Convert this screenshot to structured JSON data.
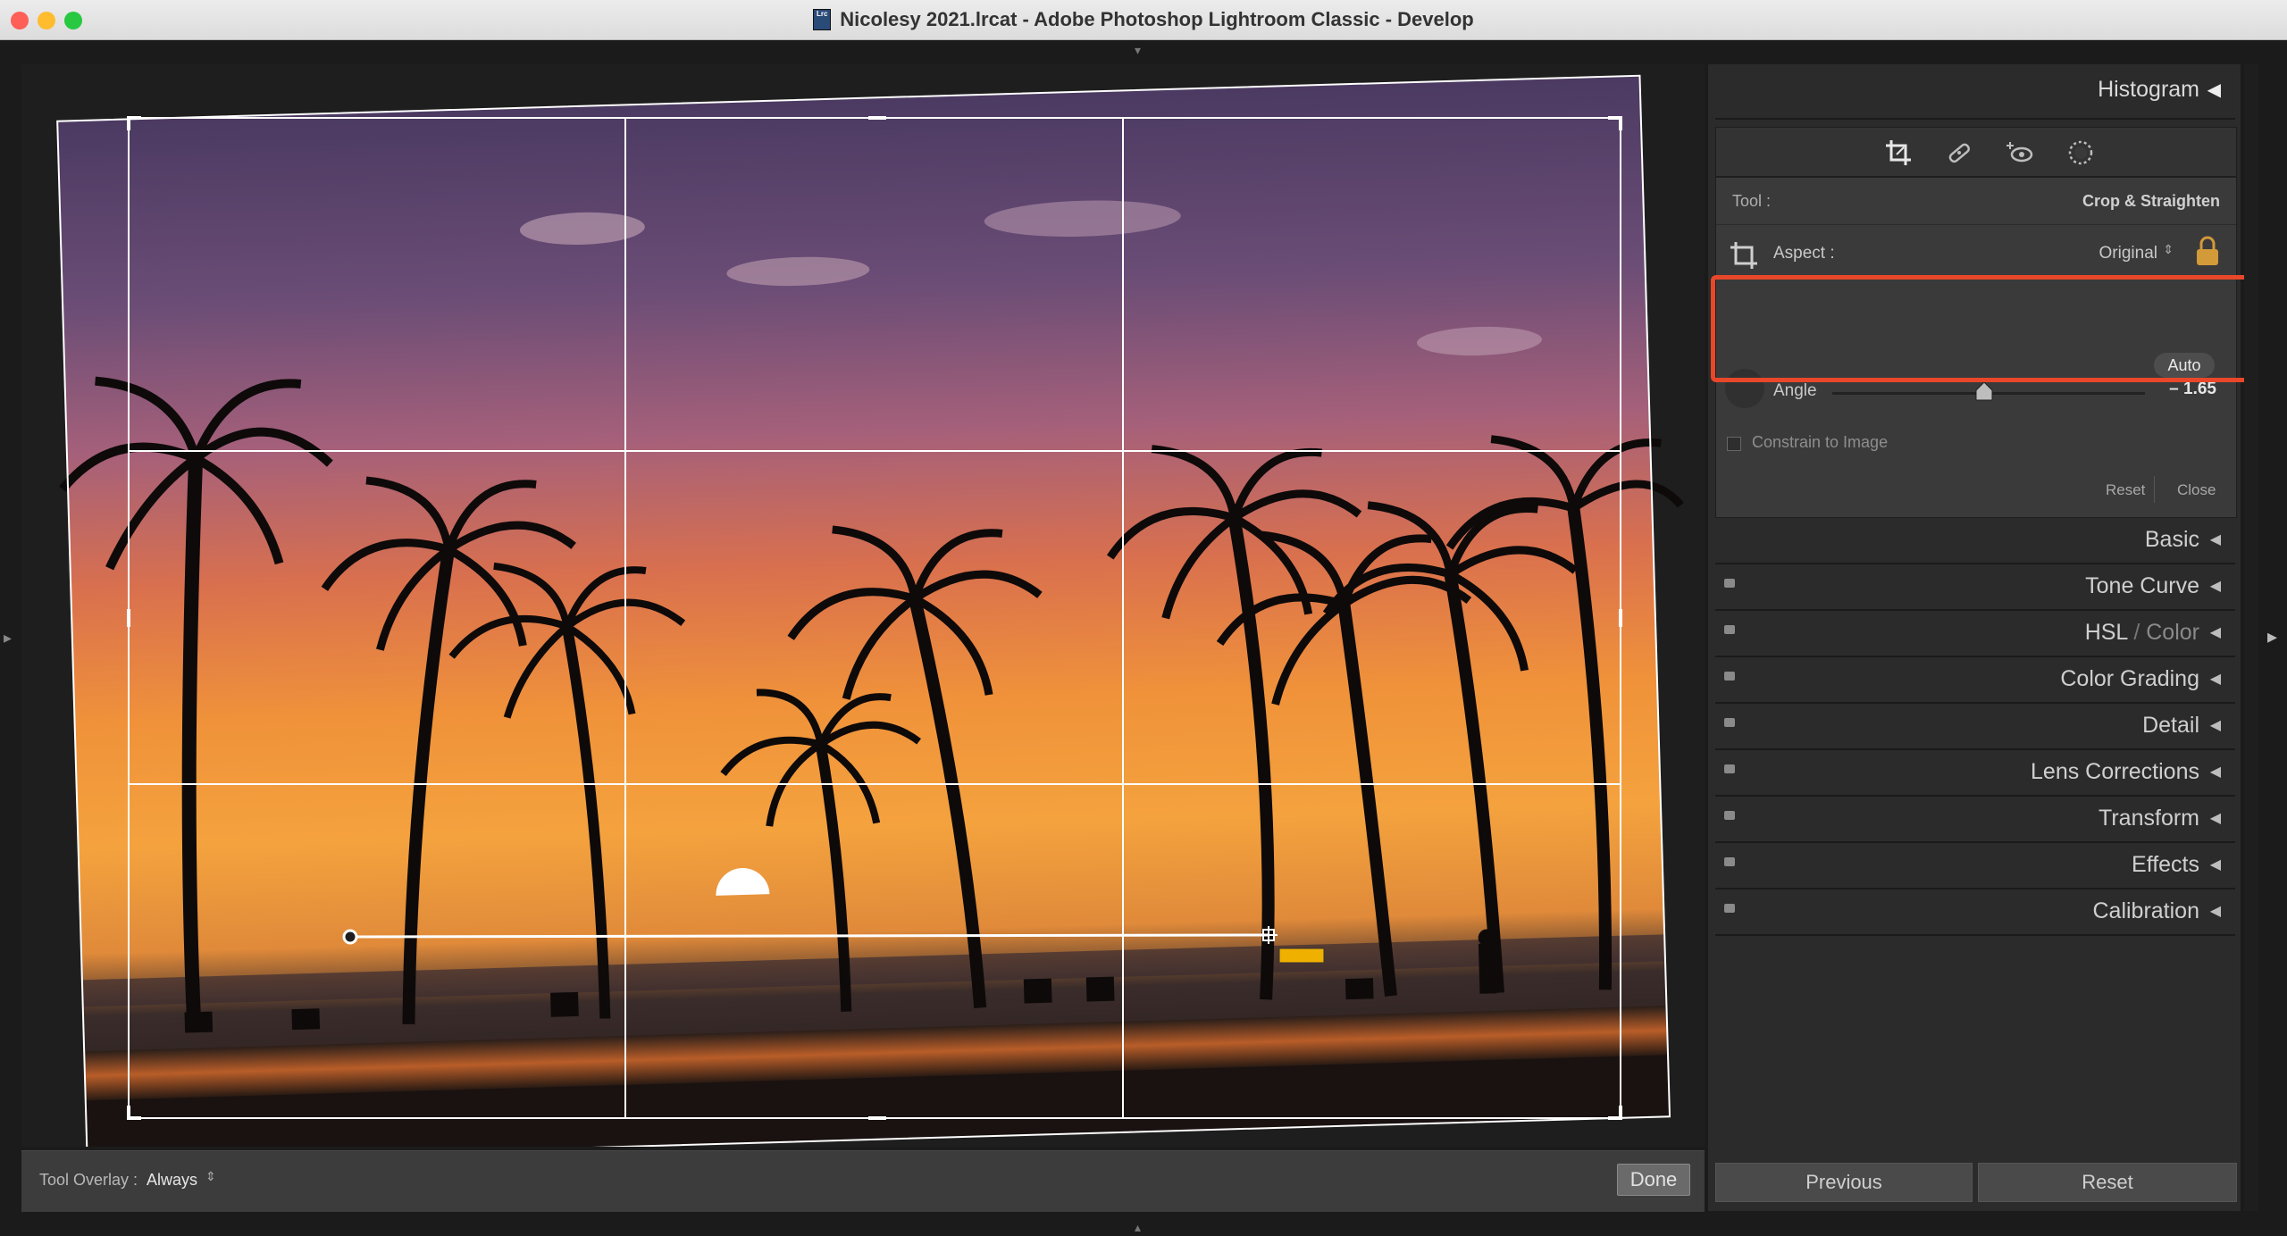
{
  "window": {
    "title": "Nicolesy 2021.lrcat - Adobe Photoshop Lightroom Classic - Develop",
    "doc_icon_text": "Lrc",
    "traffic_colors": [
      "#fe5f57",
      "#febc2e",
      "#28c840"
    ]
  },
  "canvas": {
    "toolbar": {
      "overlay_label": "Tool Overlay :",
      "overlay_value": "Always",
      "done_label": "Done"
    }
  },
  "right_panel": {
    "histogram_label": "Histogram",
    "tool_icons": [
      "crop-icon",
      "healing-brush-icon",
      "red-eye-icon",
      "masking-icon"
    ],
    "crop": {
      "tool_label": "Tool :",
      "tool_value": "Crop & Straighten",
      "aspect_label": "Aspect :",
      "aspect_value": "Original",
      "auto_label": "Auto",
      "angle_label": "Angle",
      "angle_value": "– 1.65",
      "angle_numeric": -1.65,
      "constrain_label": "Constrain to Image",
      "reset_label": "Reset",
      "close_label": "Close"
    },
    "panels": [
      {
        "label": "Basic",
        "has_switch": false
      },
      {
        "label": "Tone Curve",
        "has_switch": true
      },
      {
        "label_main": "HSL",
        "label_sep": " / ",
        "label_dim": "Color",
        "has_switch": true
      },
      {
        "label": "Color Grading",
        "has_switch": true
      },
      {
        "label": "Detail",
        "has_switch": true
      },
      {
        "label": "Lens Corrections",
        "has_switch": true
      },
      {
        "label": "Transform",
        "has_switch": true
      },
      {
        "label": "Effects",
        "has_switch": true
      },
      {
        "label": "Calibration",
        "has_switch": true
      }
    ],
    "buttons": {
      "previous": "Previous",
      "reset": "Reset"
    }
  },
  "colors": {
    "highlight": "#e8472a",
    "panel_bg": "#2b2b2b"
  }
}
